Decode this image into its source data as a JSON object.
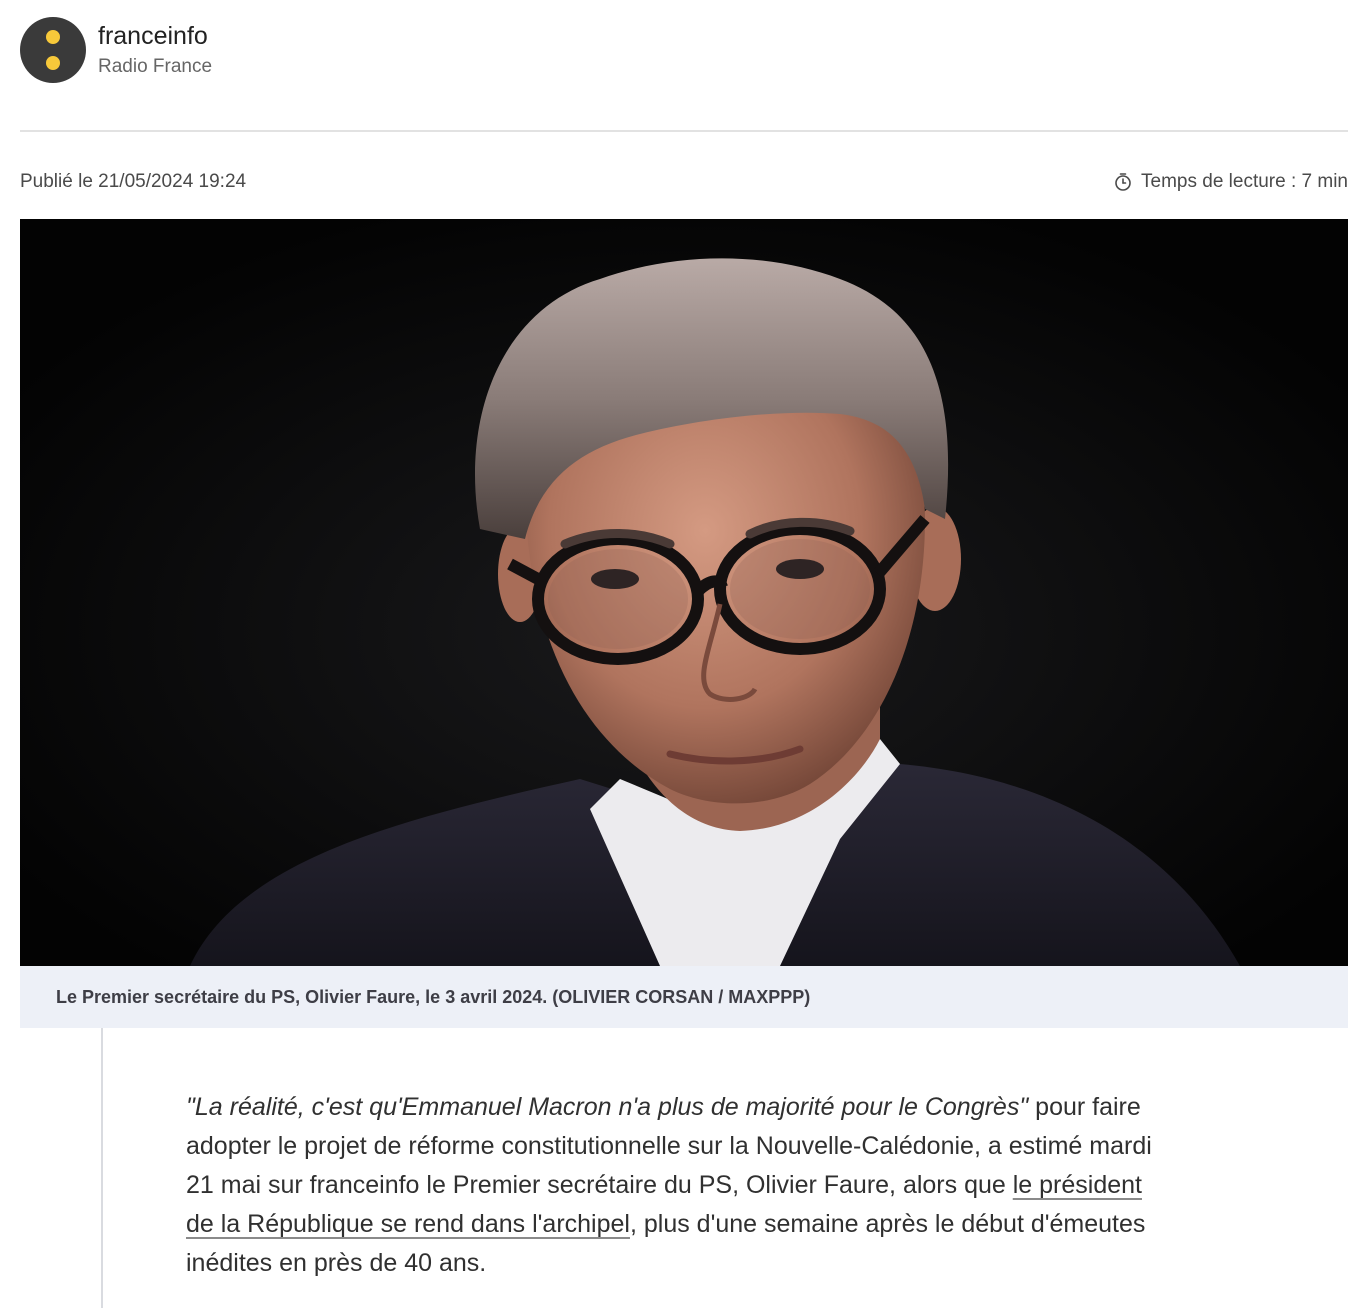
{
  "source": {
    "name": "franceinfo",
    "subtitle": "Radio France",
    "logo_icon": "franceinfo-logo-icon",
    "logo_bg": "#3a3a3a",
    "logo_dot_color": "#f7c93a"
  },
  "meta": {
    "published": "Publié le 21/05/2024 19:24",
    "reading_time_icon": "timer-icon",
    "reading_time": "Temps de lecture : 7 min"
  },
  "hero": {
    "caption": "Le Premier secrétaire du PS, Olivier Faure, le 3 avril 2024. (OLIVIER CORSAN / MAXPPP)"
  },
  "article": {
    "quote": "\"La réalité, c'est qu'Emmanuel Macron n'a plus de majorité pour le Congrès\"",
    "text_1": " pour faire adopter le projet de réforme constitutionnelle sur la Nouvelle-Calédonie, a estimé mardi 21 mai sur franceinfo le Premier secrétaire du PS, Olivier Faure, alors que ",
    "link": "le président de la République se rend dans l'archipel",
    "text_2": ", plus d'une semaine après le début d'émeutes inédites en près de 40 ans."
  }
}
